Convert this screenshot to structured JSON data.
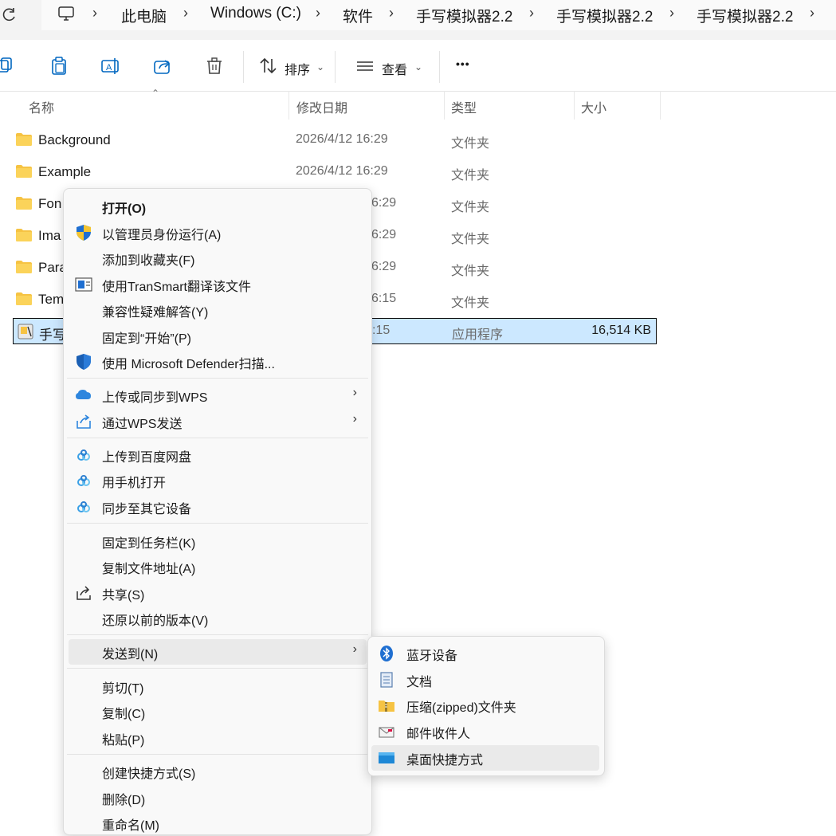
{
  "address_bar": {
    "crumbs": [
      "此电脑",
      "Windows (C:)",
      "软件",
      "手写模拟器2.2",
      "手写模拟器2.2",
      "手写模拟器2.2"
    ]
  },
  "toolbar": {
    "sort_label": "排序",
    "view_label": "查看",
    "more_label": "•••"
  },
  "columns": {
    "name": "名称",
    "modified": "修改日期",
    "type": "类型",
    "size": "大小"
  },
  "files": [
    {
      "name": "Background",
      "date": "2026/4/12 16:29",
      "type": "文件夹",
      "size": ""
    },
    {
      "name": "Example",
      "date": "2026/4/12 16:29",
      "type": "文件夹",
      "size": ""
    },
    {
      "name": "Fon",
      "date": "6:29",
      "type": "文件夹",
      "size": ""
    },
    {
      "name": "Ima",
      "date": "6:29",
      "type": "文件夹",
      "size": ""
    },
    {
      "name": "Para",
      "date": "6:29",
      "type": "文件夹",
      "size": ""
    },
    {
      "name": "Tem",
      "date": "6:15",
      "type": "文件夹",
      "size": ""
    },
    {
      "name": "手写",
      "date": ":15",
      "type": "应用程序",
      "size": "16,514 KB"
    }
  ],
  "context_menu": {
    "items": [
      {
        "label": "打开(O)"
      },
      {
        "label": "以管理员身份运行(A)"
      },
      {
        "label": "添加到收藏夹(F)"
      },
      {
        "label": "使用TranSmart翻译该文件"
      },
      {
        "label": "兼容性疑难解答(Y)"
      },
      {
        "label": "固定到“开始”(P)"
      },
      {
        "label": "使用 Microsoft Defender扫描..."
      },
      {
        "label": "上传或同步到WPS"
      },
      {
        "label": "通过WPS发送"
      },
      {
        "label": "上传到百度网盘"
      },
      {
        "label": "用手机打开"
      },
      {
        "label": "同步至其它设备"
      },
      {
        "label": "固定到任务栏(K)"
      },
      {
        "label": "复制文件地址(A)"
      },
      {
        "label": "共享(S)"
      },
      {
        "label": "还原以前的版本(V)"
      },
      {
        "label": "发送到(N)"
      },
      {
        "label": "剪切(T)"
      },
      {
        "label": "复制(C)"
      },
      {
        "label": "粘贴(P)"
      },
      {
        "label": "创建快捷方式(S)"
      },
      {
        "label": "删除(D)"
      },
      {
        "label": "重命名(M)"
      }
    ]
  },
  "send_to_menu": {
    "items": [
      {
        "label": "蓝牙设备"
      },
      {
        "label": "文档"
      },
      {
        "label": "压缩(zipped)文件夹"
      },
      {
        "label": "邮件收件人"
      },
      {
        "label": "桌面快捷方式"
      }
    ]
  },
  "colors": {
    "selection": "#cce8ff",
    "folder": "#f6c343",
    "accent": "#0067c0"
  }
}
